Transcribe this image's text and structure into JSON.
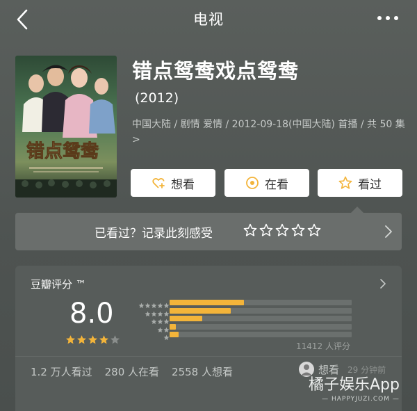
{
  "nav": {
    "title": "电视"
  },
  "show": {
    "name": "错点鸳鸯戏点鸳鸯",
    "year": "(2012)",
    "meta": "中国大陆 / 剧情 爱情 / 2012-09-18(中国大陆) 首播 / 共 50 集 >",
    "poster_title": "错点鸳鸯"
  },
  "actions": [
    {
      "label": "想看",
      "icon": "heart-plus-icon"
    },
    {
      "label": "在看",
      "icon": "target-circle-icon"
    },
    {
      "label": "看过",
      "icon": "star-outline-icon"
    }
  ],
  "prompt": {
    "text": "已看过？记录此刻感受",
    "star_count": 5
  },
  "rating": {
    "title": "豆瓣评分 ™",
    "score": "8.0",
    "stars_filled": 4,
    "distribution": [
      41.0,
      33.5,
      18.0,
      3.5,
      5.0
    ],
    "count_text": "11412 人评分"
  },
  "stats": {
    "watched": "1.2 万人看过",
    "watching": "280 人在看",
    "wish": "2558 人想看"
  },
  "activity": {
    "who": "想看",
    "when": "29 分钟前"
  },
  "watermark": {
    "brand": "橘子娱乐App",
    "url": "— HAPPYJUZI.COM —"
  },
  "colors": {
    "accent": "#f3b43a",
    "background": "#545957",
    "button": "#ffffff"
  }
}
